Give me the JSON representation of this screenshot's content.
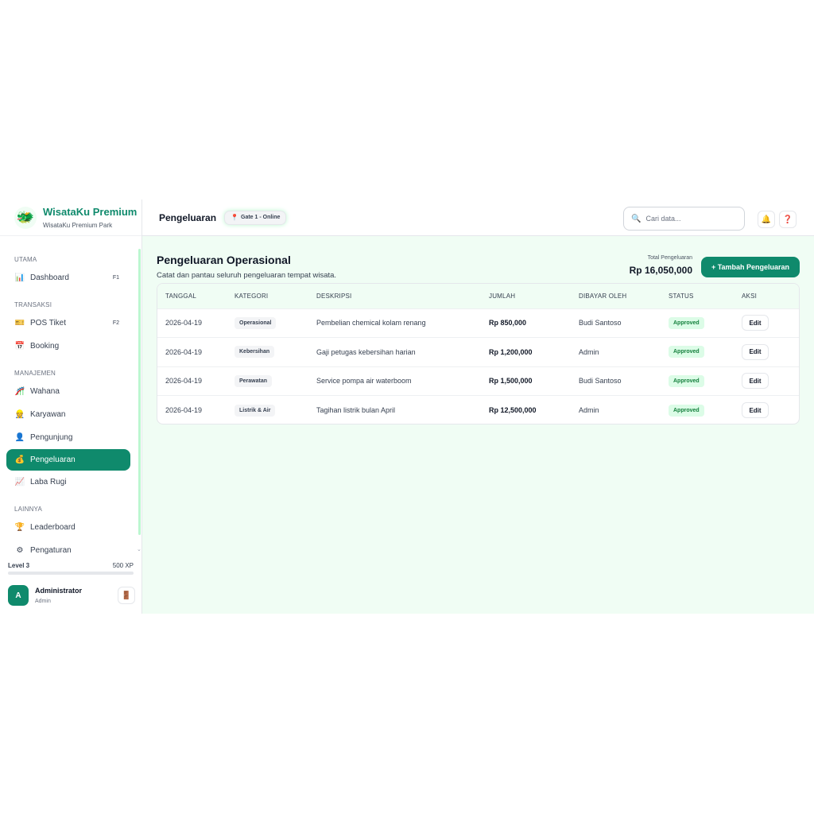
{
  "brand": {
    "title": "WisataKu Premium",
    "subtitle": "WisataKu Premium Park",
    "logo_icon": "dragon-mascot-icon"
  },
  "sidebar": {
    "sections": [
      {
        "label": "UTAMA",
        "items": [
          {
            "label": "Dashboard",
            "icon": "chart-icon",
            "glyph": "📊",
            "shortcut": "F1"
          }
        ]
      },
      {
        "label": "TRANSAKSI",
        "items": [
          {
            "label": "POS Tiket",
            "icon": "ticket-icon",
            "glyph": "🎫",
            "shortcut": "F2"
          },
          {
            "label": "Booking",
            "icon": "calendar-icon",
            "glyph": "📅",
            "shortcut": ""
          }
        ]
      },
      {
        "label": "MANAJEMEN",
        "items": [
          {
            "label": "Wahana",
            "icon": "ride-icon",
            "glyph": "🎢",
            "shortcut": ""
          },
          {
            "label": "Karyawan",
            "icon": "staff-icon",
            "glyph": "👷",
            "shortcut": ""
          },
          {
            "label": "Pengunjung",
            "icon": "visitor-icon",
            "glyph": "👤",
            "shortcut": ""
          },
          {
            "label": "Pengeluaran",
            "icon": "money-bag-icon",
            "glyph": "💰",
            "shortcut": "",
            "active": true
          },
          {
            "label": "Laba Rugi",
            "icon": "trend-chart-icon",
            "glyph": "📈",
            "shortcut": ""
          }
        ]
      },
      {
        "label": "LAINNYA",
        "items": [
          {
            "label": "Leaderboard",
            "icon": "trophy-icon",
            "glyph": "🏆",
            "shortcut": ""
          },
          {
            "label": "Pengaturan",
            "icon": "gear-icon",
            "glyph": "⚙",
            "shortcut": ""
          }
        ]
      }
    ],
    "level": {
      "label": "Level 3",
      "xp": "500 XP",
      "progress": 0
    },
    "user": {
      "initial": "A",
      "name": "Administrator",
      "role": "Admin",
      "logout_icon": "door-icon"
    }
  },
  "topbar": {
    "title": "Pengeluaran",
    "gate": "Gate 1 - Online",
    "search_placeholder": "Cari data...",
    "search_icon": "search-icon",
    "bell_icon": "bell-icon",
    "help_icon": "help-icon"
  },
  "page": {
    "title": "Pengeluaran Operasional",
    "subtitle": "Catat dan pantau seluruh pengeluaran tempat wisata.",
    "total_label": "Total Pengeluaran",
    "total_value": "Rp 16,050,000",
    "add_button": "+ Tambah Pengeluaran"
  },
  "table": {
    "columns": [
      "TANGGAL",
      "KATEGORI",
      "DESKRIPSI",
      "JUMLAH",
      "DIBAYAR OLEH",
      "STATUS",
      "AKSI"
    ],
    "rows": [
      {
        "date": "2026-04-19",
        "category": "Operasional",
        "description": "Pembelian chemical kolam renang",
        "amount": "Rp 850,000",
        "paid_by": "Budi Santoso",
        "status": "Approved",
        "action": "Edit"
      },
      {
        "date": "2026-04-19",
        "category": "Kebersihan",
        "description": "Gaji petugas kebersihan harian",
        "amount": "Rp 1,200,000",
        "paid_by": "Admin",
        "status": "Approved",
        "action": "Edit"
      },
      {
        "date": "2026-04-19",
        "category": "Perawatan",
        "description": "Service pompa air waterboom",
        "amount": "Rp 1,500,000",
        "paid_by": "Budi Santoso",
        "status": "Approved",
        "action": "Edit"
      },
      {
        "date": "2026-04-19",
        "category": "Listrik & Air",
        "description": "Tagihan listrik bulan April",
        "amount": "Rp 12,500,000",
        "paid_by": "Admin",
        "status": "Approved",
        "action": "Edit"
      }
    ]
  },
  "colors": {
    "accent": "#0f8a6c",
    "background": "#f0fdf4",
    "status_bg": "#dcfce7",
    "status_text": "#15803d"
  }
}
